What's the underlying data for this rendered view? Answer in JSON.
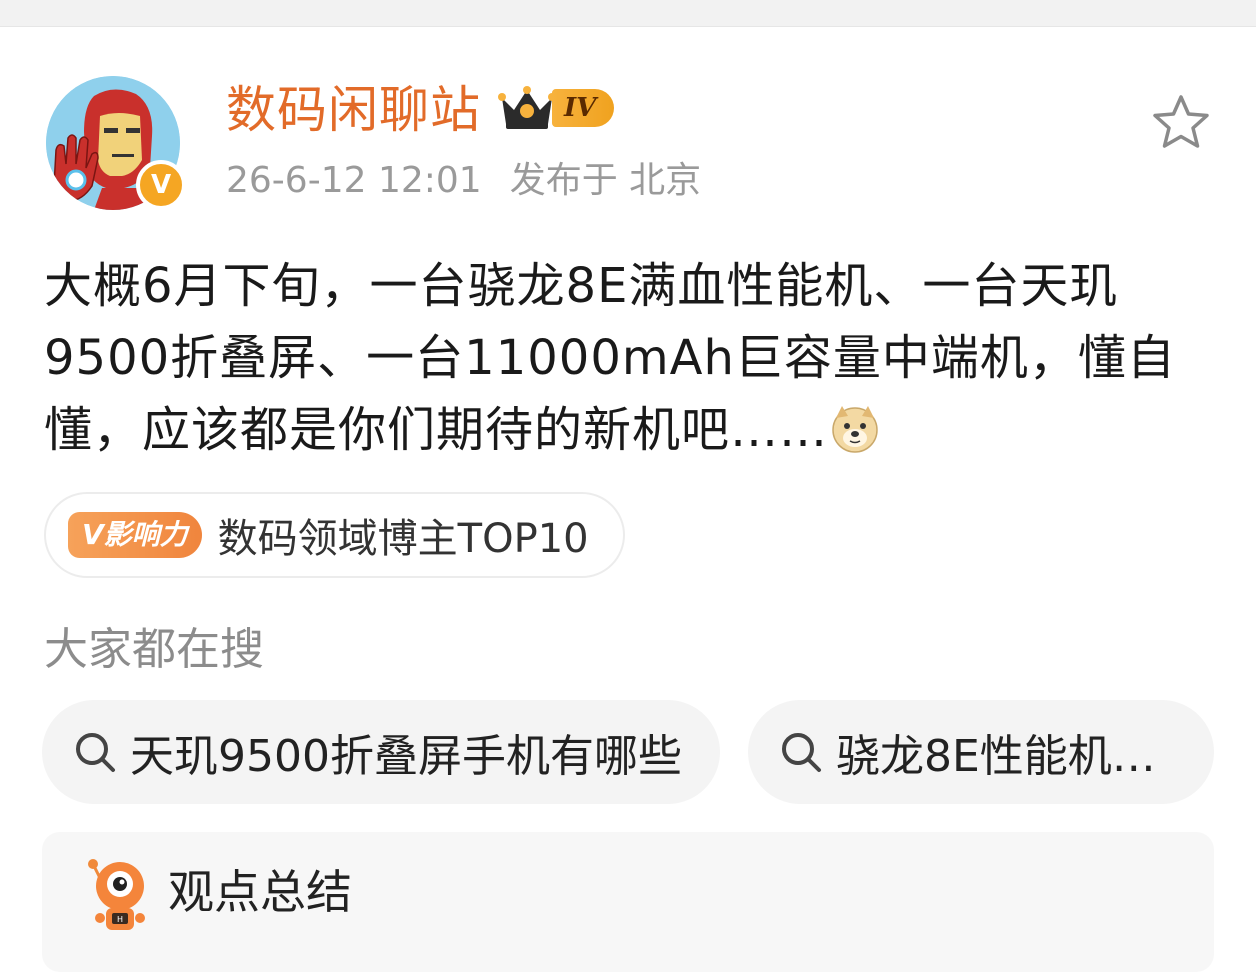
{
  "post": {
    "username": "数码闲聊站",
    "level": "IV",
    "verified_mark": "V",
    "time": "26-6-12 12:01",
    "location": "发布于 北京",
    "text": "大概6月下旬，一台骁龙8E满血性能机、一台天玑9500折叠屏、一台11000mAh巨容量中端机，懂自懂，应该都是你们期待的新机吧……",
    "emoji_icon": "doge-emoji-icon"
  },
  "influence": {
    "tag": "V影响力",
    "text": "数码领域博主TOP10"
  },
  "trending": {
    "label": "大家都在搜",
    "items": [
      {
        "text": "天玑9500折叠屏手机有哪些"
      },
      {
        "text": "骁龙8E性能机…"
      }
    ]
  },
  "summary": {
    "title": "观点总结"
  },
  "colors": {
    "username": "#e26b29",
    "level_badge": "#f7b23d",
    "verified_badge": "#f5a623",
    "influence_tag": "#f0853d",
    "meta_text": "#9a9a9a",
    "chip_bg": "#f4f4f4"
  }
}
